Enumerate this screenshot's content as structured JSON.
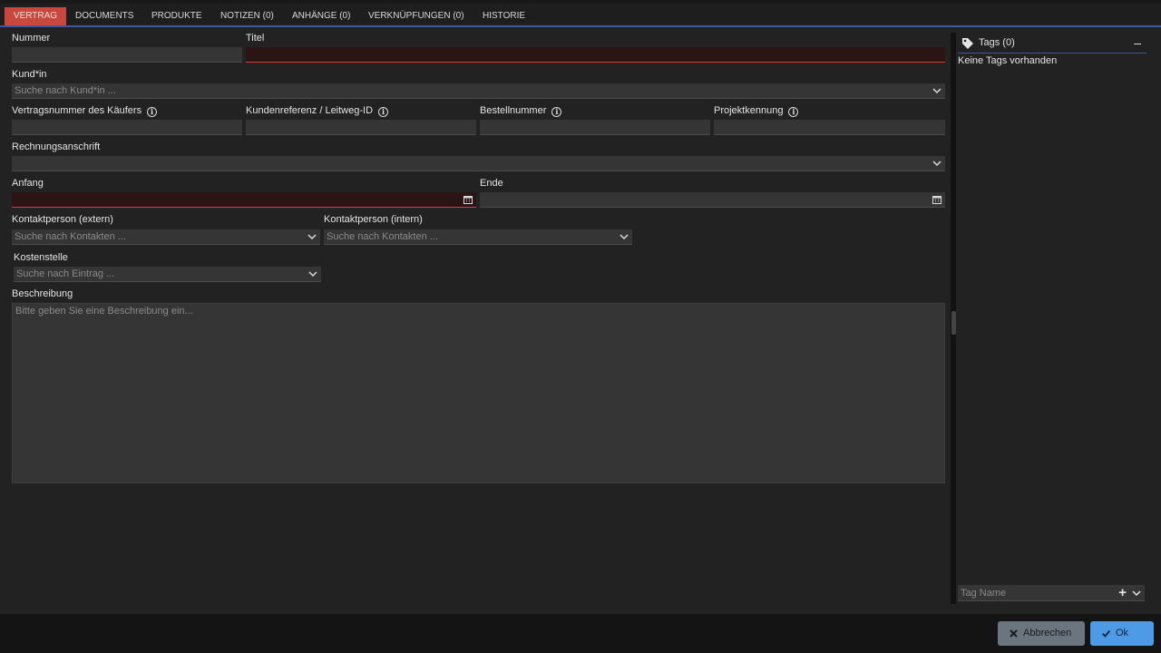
{
  "tabs": [
    {
      "label": "VERTRAG",
      "active": true
    },
    {
      "label": "DOCUMENTS"
    },
    {
      "label": "PRODUKTE"
    },
    {
      "label": "NOTIZEN (0)"
    },
    {
      "label": "ANHÄNGE (0)"
    },
    {
      "label": "VERKNÜPFUNGEN (0)"
    },
    {
      "label": "HISTORIE"
    }
  ],
  "form": {
    "nummer_label": "Nummer",
    "titel_label": "Titel",
    "kunde_label": "Kund*in",
    "kunde_placeholder": "Suche nach Kund*in ...",
    "vertragsnummer_label": "Vertragsnummer des Käufers",
    "kundenreferenz_label": "Kundenreferenz / Leitweg-ID",
    "bestellnummer_label": "Bestellnummer",
    "projektkennung_label": "Projektkennung",
    "rechnungsanschrift_label": "Rechnungsanschrift",
    "anfang_label": "Anfang",
    "ende_label": "Ende",
    "kontakt_extern_label": "Kontaktperson (extern)",
    "kontakt_intern_label": "Kontaktperson (intern)",
    "kontakt_placeholder": "Suche nach Kontakten ...",
    "kostenstelle_label": "Kostenstelle",
    "kostenstelle_placeholder": "Suche nach Eintrag ...",
    "beschreibung_label": "Beschreibung",
    "beschreibung_placeholder": "Bitte geben Sie eine Beschreibung ein...",
    "info_glyph": "i"
  },
  "tags": {
    "title": "Tags (0)",
    "collapse": "–",
    "empty_text": "Keine Tags vorhanden",
    "input_placeholder": "Tag Name",
    "add": "+"
  },
  "footer": {
    "cancel_label": "Abbrechen",
    "ok_label": "Ok"
  },
  "colors": {
    "accent": "#3c5a9a",
    "active_tab": "#c9473d",
    "error": "#d04040",
    "ok_button": "#4d9ae6",
    "cancel_button": "#6b7580"
  }
}
